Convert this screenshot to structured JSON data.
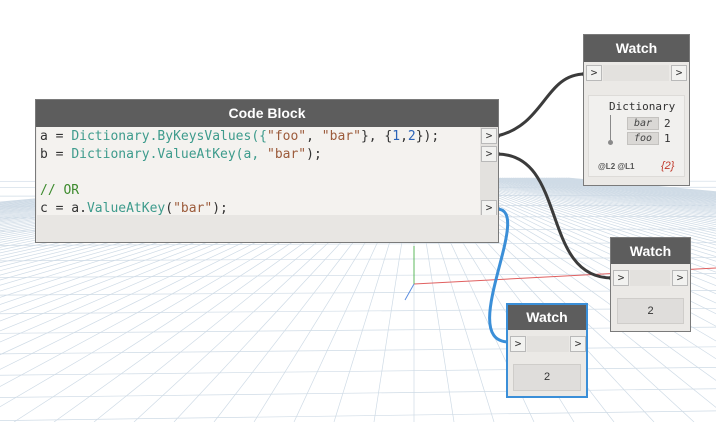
{
  "code_block": {
    "title": "Code Block",
    "lines": [
      {
        "a": "a = ",
        "b": "Dictionary",
        "c": ".ByKeysValues({",
        "d": "\"foo\"",
        "e": ", ",
        "f": "\"bar\"",
        "g": "}, {",
        "h": "1",
        "i": ",",
        "j": "2",
        "k": "});"
      },
      {
        "a": "b = ",
        "b": "Dictionary",
        "c": ".ValueAtKey(a, ",
        "d": "\"bar\"",
        "e": ");"
      },
      {
        "a": "// OR"
      },
      {
        "a": "c = a.",
        "b": "ValueAtKey",
        "c": "(",
        "d": "\"bar\"",
        "e": ");"
      }
    ],
    "port_glyph": ">"
  },
  "watch_dict": {
    "title": "Watch",
    "type_label": "Dictionary",
    "entries": [
      {
        "key": "bar",
        "value": "2"
      },
      {
        "key": "foo",
        "value": "1"
      }
    ],
    "levels": "@L2 @L1",
    "count": "{2}"
  },
  "watch_b": {
    "title": "Watch",
    "value": "2"
  },
  "watch_c": {
    "title": "Watch",
    "value": "2"
  },
  "port_glyph": ">",
  "colors": {
    "header": "#5d5d5d",
    "wire": "#3b3b3b",
    "wire_selected": "#3b8fd8",
    "grid": "#cfdbe6"
  }
}
